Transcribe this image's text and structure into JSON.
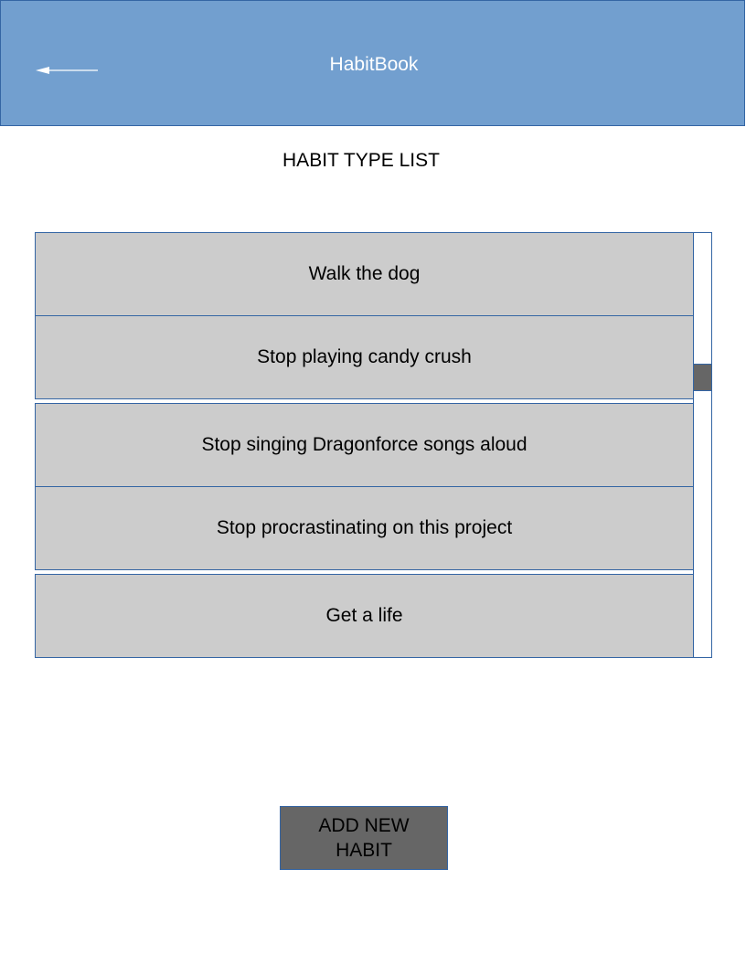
{
  "header": {
    "title": "HabitBook",
    "back_icon": "arrow-left-icon",
    "background_color": "#729fcf",
    "border_color": "#3465a4"
  },
  "page": {
    "title": "HABIT TYPE LIST"
  },
  "habits": [
    {
      "label": "Walk the dog"
    },
    {
      "label": "Stop playing candy crush"
    },
    {
      "label": "Stop singing Dragonforce songs aloud"
    },
    {
      "label": "Stop procrastinating on this project"
    },
    {
      "label": "Get a life"
    }
  ],
  "list": {
    "item_color": "#cccccc",
    "scroll_position": 0.33
  },
  "actions": {
    "add_label": "ADD NEW HABIT",
    "button_color": "#666666"
  }
}
